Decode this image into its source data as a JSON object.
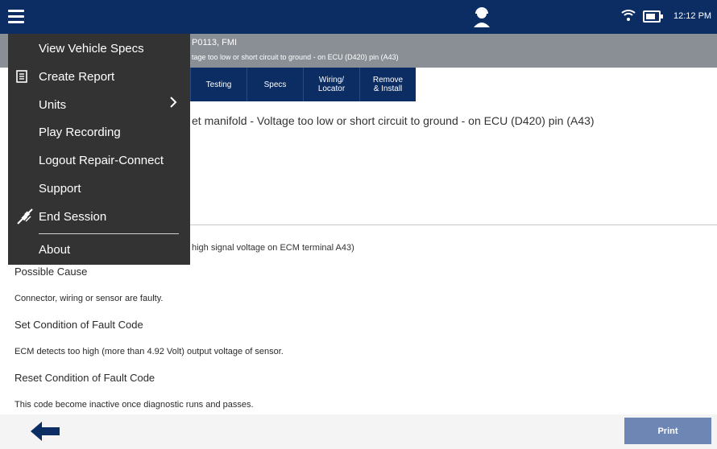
{
  "header": {
    "time": "12:12 PM"
  },
  "code": {
    "title": "P0113, FMI",
    "subtitle": "tage too low or short circuit to ground - on ECU (D420) pin (A43)"
  },
  "tabs": [
    "Testing",
    "Specs",
    "Wiring/\nLocator",
    "Remove\n& Install"
  ],
  "content": {
    "description": "et manifold - Voltage too low or short circuit to ground - on ECU (D420) pin (A43)",
    "symptom": "high signal voltage on ECM terminal A43)",
    "possible_cause_heading": "Possible Cause",
    "possible_cause_text": "Connector, wiring or sensor are faulty.",
    "set_condition_heading": "Set Condition of Fault Code",
    "set_condition_text": "ECM detects too high (more than 4.92 Volt) output voltage of sensor.",
    "reset_condition_heading": "Reset Condition of Fault Code",
    "reset_condition_text": "This code become inactive once diagnostic runs and passes."
  },
  "menu": {
    "view_specs": "View Vehicle Specs",
    "create_report": "Create Report",
    "units": "Units",
    "play_recording": "Play Recording",
    "logout": "Logout Repair-Connect",
    "support": "Support",
    "end_session": "End Session",
    "about": "About"
  },
  "footer": {
    "print": "Print"
  },
  "icons": {
    "menu": "hamburger-icon",
    "technician": "technician-icon",
    "wifi": "wifi-icon",
    "battery": "battery-icon",
    "report": "document-icon",
    "chevron": "chevron-right-icon",
    "end_session": "unplug-icon",
    "back": "arrow-left-icon"
  },
  "colors": {
    "header": "#0c2d63",
    "code_bar": "#8a8f96",
    "menu_bg": "#333333",
    "print_button": "#6d86b4"
  }
}
